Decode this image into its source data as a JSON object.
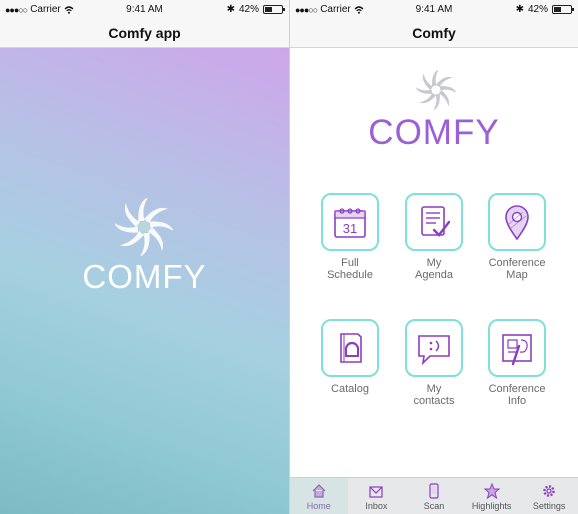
{
  "status_bar": {
    "carrier": "Carrier",
    "time": "9:41 AM",
    "battery": "42%",
    "battery_level": 0.42
  },
  "left_screen": {
    "title": "Comfy app",
    "logo_text": "COMFY"
  },
  "right_screen": {
    "title": "Comfy",
    "logo_text": "COMFY",
    "tiles": [
      {
        "line1": "Full",
        "line2": "Schedule",
        "icon": "calendar-icon",
        "calendar_day": "31"
      },
      {
        "line1": "My",
        "line2": "Agenda",
        "icon": "checklist-icon"
      },
      {
        "line1": "Conference",
        "line2": "Map",
        "icon": "map-pin-icon"
      },
      {
        "line1": "Catalog",
        "line2": "",
        "icon": "catalog-icon"
      },
      {
        "line1": "My",
        "line2": "contacts",
        "icon": "chat-bubble-icon"
      },
      {
        "line1": "Conference",
        "line2": "Info",
        "icon": "blueprint-icon"
      }
    ],
    "tab_bar": [
      {
        "label": "Home",
        "icon": "home-icon",
        "active": true
      },
      {
        "label": "Inbox",
        "icon": "inbox-icon",
        "active": false
      },
      {
        "label": "Scan",
        "icon": "phone-scan-icon",
        "active": false
      },
      {
        "label": "Highlights",
        "icon": "star-icon",
        "active": false
      },
      {
        "label": "Settings",
        "icon": "gear-icon",
        "active": false
      }
    ]
  },
  "colors": {
    "accent_purple": "#9b5fd6",
    "tile_border": "#7fe0d8",
    "icon_purple": "#8a3fc0"
  }
}
